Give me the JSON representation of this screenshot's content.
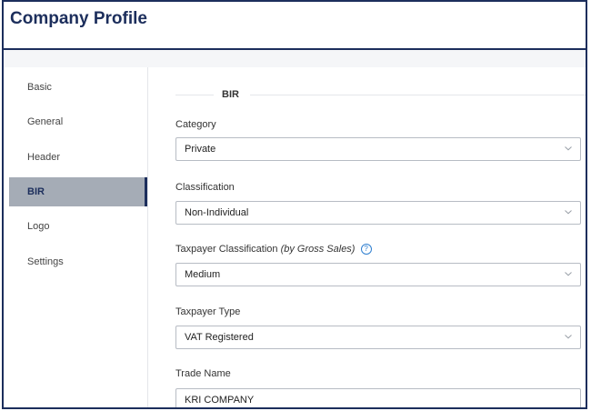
{
  "app": {
    "title": "Company Profile"
  },
  "sidebar": {
    "items": [
      {
        "label": "Basic",
        "active": false
      },
      {
        "label": "General",
        "active": false
      },
      {
        "label": "Header",
        "active": false
      },
      {
        "label": "BIR",
        "active": true
      },
      {
        "label": "Logo",
        "active": false
      },
      {
        "label": "Settings",
        "active": false
      }
    ]
  },
  "section": {
    "title": "BIR"
  },
  "fields": {
    "category": {
      "label": "Category",
      "value": "Private"
    },
    "classification": {
      "label": "Classification",
      "value": "Non-Individual"
    },
    "taxpayer_classification": {
      "label": "Taxpayer Classification",
      "label_note": "(by Gross Sales)",
      "help_glyph": "?",
      "value": "Medium"
    },
    "taxpayer_type": {
      "label": "Taxpayer Type",
      "value": "VAT Registered"
    },
    "trade_name": {
      "label": "Trade Name",
      "value": "KRI COMPANY"
    }
  },
  "icons": {
    "chevron": "chevron-down-icon",
    "help": "help-circle-icon"
  },
  "colors": {
    "brand": "#1c2e5c",
    "active_bg": "#a5acb6",
    "help": "#2f7fd0"
  }
}
